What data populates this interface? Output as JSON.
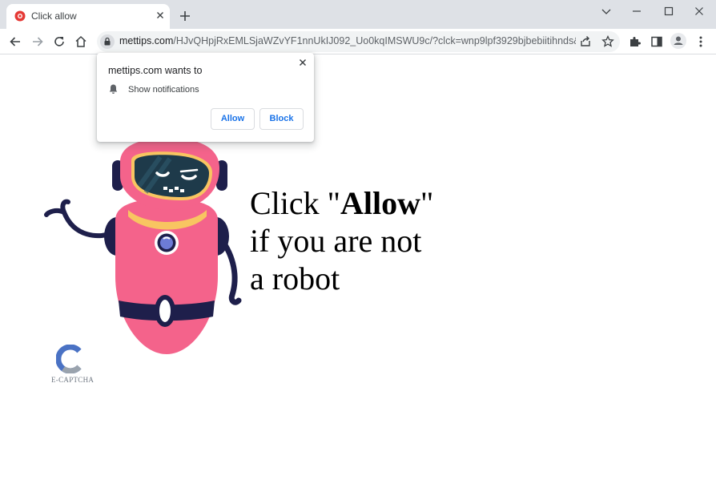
{
  "browser": {
    "tab": {
      "title": "Click allow"
    },
    "omnibox": {
      "host": "mettips.com",
      "path": "/HJvQHpjRxEMLSjaWZvYF1nnUkIJ092_Uo0kqIMSWU9c/?clck=wnp9lpf3929bjbebiitihnds&sid..."
    }
  },
  "permission_popup": {
    "title": "mettips.com wants to",
    "item": "Show notifications",
    "allow_label": "Allow",
    "block_label": "Block"
  },
  "page": {
    "headline_prefix": "Click \"",
    "headline_bold": "Allow",
    "headline_suffix": "\"",
    "headline_line2": "if you are not",
    "headline_line3": "a robot",
    "captcha_label": "E-CAPTCHA"
  },
  "colors": {
    "accent_blue": "#1a73e8",
    "robot_pink": "#f4638b",
    "robot_navy": "#1e1f4b",
    "robot_yellow": "#f8c561"
  }
}
